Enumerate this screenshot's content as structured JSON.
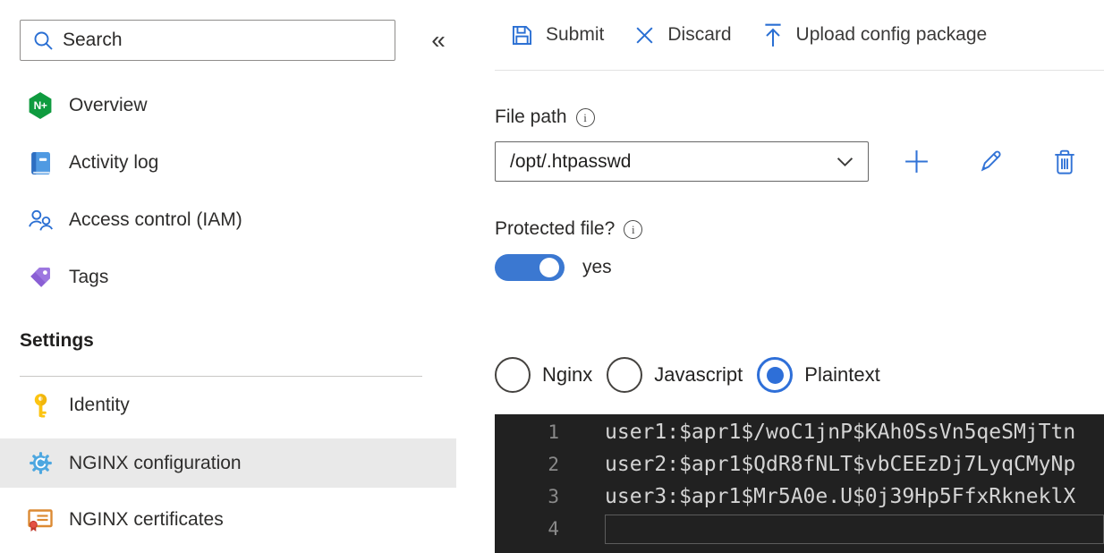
{
  "colors": {
    "accent_blue": "#3273d6",
    "toggle_blue": "#3b78d1",
    "nginx_green": "#0f9b3f",
    "gear_blue": "#4da7e0",
    "tag_purple": "#8a5fd4",
    "key_gold": "#fcc412",
    "cert_orange": "#dc8a33",
    "cert_red": "#d6473b",
    "active_item_bg": "#e9e9e9",
    "editor_bg": "#212121",
    "editor_text": "#d4d4d4",
    "editor_line_number": "#8a8a8a"
  },
  "sidebar": {
    "search": {
      "placeholder": "Search"
    },
    "collapse_glyph": "«",
    "overview_icon_text": "N+",
    "items": [
      {
        "label": "Overview"
      },
      {
        "label": "Activity log"
      },
      {
        "label": "Access control (IAM)"
      },
      {
        "label": "Tags"
      }
    ],
    "section_header": "Settings",
    "settings_items": [
      {
        "label": "Identity"
      },
      {
        "label": "NGINX configuration",
        "active": true
      },
      {
        "label": "NGINX certificates"
      }
    ]
  },
  "toolbar": {
    "submit_label": "Submit",
    "discard_label": "Discard",
    "upload_label": "Upload config package"
  },
  "file_path": {
    "label": "File path",
    "value": "/opt/.htpasswd"
  },
  "protected_file": {
    "label": "Protected file?",
    "state": "yes"
  },
  "format_options": [
    {
      "label": "Nginx",
      "selected": false
    },
    {
      "label": "Javascript",
      "selected": false
    },
    {
      "label": "Plaintext",
      "selected": true
    }
  ],
  "editor": {
    "lines": [
      {
        "number": "1",
        "code": "user1:$apr1$/woC1jnP$KAh0SsVn5qeSMjTtn"
      },
      {
        "number": "2",
        "code": "user2:$apr1$QdR8fNLT$vbCEEzDj7LyqCMyNp"
      },
      {
        "number": "3",
        "code": "user3:$apr1$Mr5A0e.U$0j39Hp5FfxRkneklX"
      },
      {
        "number": "4",
        "code": ""
      }
    ]
  }
}
